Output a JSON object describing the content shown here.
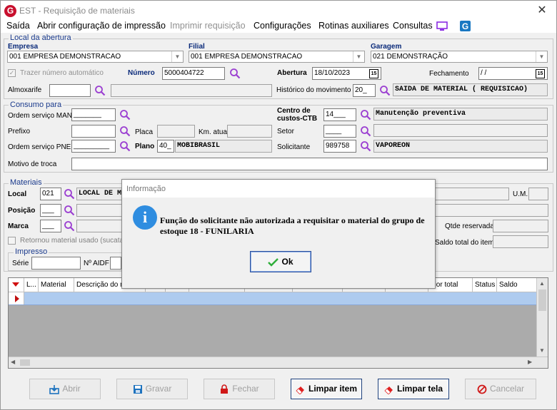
{
  "window": {
    "title": "EST - Requisição de materiais",
    "close_glyph": "✕"
  },
  "menu": {
    "saida": "Saída",
    "abrir_config": "Abrir configuração de impressão",
    "imprimir": "Imprimir requisição",
    "configuracoes": "Configurações",
    "rotinas": "Rotinas auxiliares",
    "consultas": "Consultas"
  },
  "local_abertura": {
    "legend": "Local da abertura",
    "empresa_label": "Empresa",
    "empresa_value": "001 EMPRESA DEMONSTRACAO",
    "filial_label": "Filial",
    "filial_value": "001 EMPRESA DEMONSTRACAO",
    "garagem_label": "Garagem",
    "garagem_value": "021 DEMONSTRAÇÃO",
    "trazer_label": "Trazer número automático",
    "trazer_checked": true,
    "numero_label": "Número",
    "numero_value": "5000404722",
    "abertura_label": "Abertura",
    "abertura_value": "18/10/2023",
    "fechamento_label": "Fechamento",
    "fechamento_value": "/ /",
    "cal_glyph": "15",
    "almoxarife_label": "Almoxarife",
    "almoxarife_value": "",
    "historico_label": "Histórico do movimento",
    "historico_code": "20_",
    "historico_desc": "SAIDA DE MATERIAL ( REQUISICAO)"
  },
  "consumo": {
    "legend": "Consumo para",
    "os_man_label": "Ordem serviço MAN",
    "os_man_value": "_______",
    "centro_label_1": "Centro de",
    "centro_label_2": "custos-CTB",
    "centro_code": "14___",
    "centro_desc": "Manutenção preventiva",
    "prefixo_label": "Prefixo",
    "placa_label": "Placa",
    "km_label": "Km. atual",
    "setor_label": "Setor",
    "setor_code": "____",
    "os_pne_label": "Ordem serviço PNE",
    "os_pne_value": "_________",
    "plano_label": "Plano",
    "plano_code": "40_",
    "plano_desc": "MOBIBRASIL",
    "solicitante_label": "Solicitante",
    "solicitante_code": "989758",
    "solicitante_desc": "VAPOREON",
    "motivo_label": "Motivo de troca"
  },
  "materiais": {
    "legend": "Materiais",
    "local_label": "Local",
    "local_code": "021",
    "local_desc": "LOCAL DE M",
    "posicao_label": "Posição",
    "posicao_value": "___",
    "marca_label": "Marca",
    "marca_value": "___",
    "retornou_label": "Retornou material usado (sucata)",
    "um_label": "U.M.",
    "qtde_label": "Qtde reservada",
    "saldo_label": "Saldo total do item",
    "impresso_legend": "Impresso",
    "serie_label": "Série",
    "aidf_label": "Nº AIDF"
  },
  "grid": {
    "columns": [
      "",
      "L...",
      "Material",
      "Descrição do m",
      "",
      "",
      "",
      "",
      "",
      "",
      "",
      "",
      "alor total",
      "Status",
      "Saldo"
    ]
  },
  "buttons": {
    "abrir": "Abrir",
    "gravar": "Gravar",
    "fechar": "Fechar",
    "limpar_item": "Limpar item",
    "limpar_tela": "Limpar tela",
    "cancelar": "Cancelar"
  },
  "dialog": {
    "title": "Informação",
    "icon_glyph": "i",
    "message": "Função do solicitante não autorizada a requisitar o material do grupo de estoque 18 - FUNILARIA",
    "ok_label": "Ok"
  }
}
